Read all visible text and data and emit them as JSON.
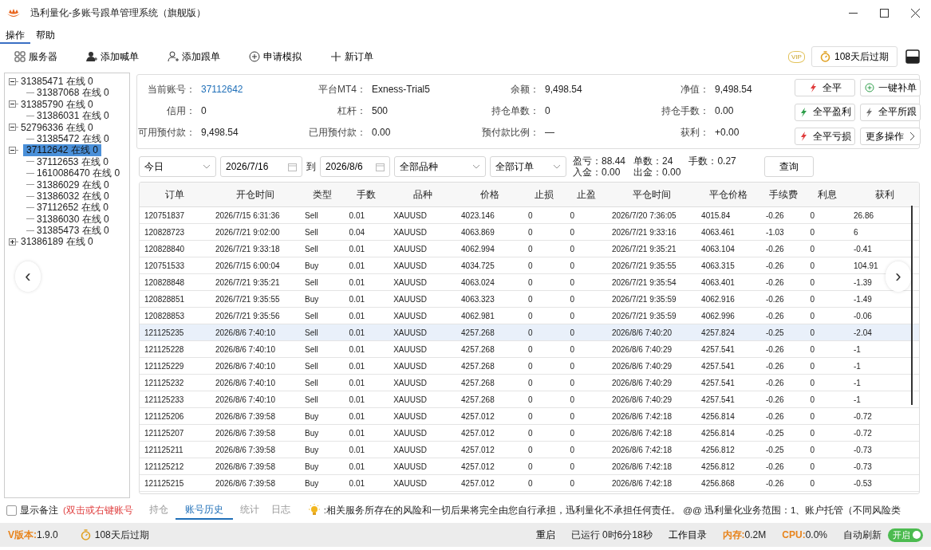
{
  "window": {
    "title": "迅利量化-多账号跟单管理系统（旗舰版）"
  },
  "menu": [
    {
      "label": "操作",
      "selected": true
    },
    {
      "label": "帮助",
      "selected": false
    }
  ],
  "toolbar": [
    "服务器",
    "添加喊单",
    "添加跟单",
    "申请模拟",
    "新订单"
  ],
  "vip": {
    "badge": "VIP",
    "expiry": "108天后过期"
  },
  "tree": [
    {
      "label": "31385471 在线 0",
      "selected": false,
      "expanded": true,
      "children": [
        {
          "label": "31387068 在线 0",
          "selected": false
        }
      ]
    },
    {
      "label": "31385790 在线 0",
      "selected": false,
      "expanded": true,
      "children": [
        {
          "label": "31386031 在线 0",
          "selected": false
        }
      ]
    },
    {
      "label": "52796336 在线 0",
      "selected": false,
      "expanded": true,
      "children": [
        {
          "label": "31385472 在线 0",
          "selected": false
        }
      ]
    },
    {
      "label": "37112642 在线 0",
      "selected": true,
      "expanded": true,
      "children": [
        {
          "label": "37112653 在线 0",
          "selected": false
        },
        {
          "label": "1610086470 在线 0",
          "selected": false
        },
        {
          "label": "31386029 在线 0",
          "selected": false
        },
        {
          "label": "31386032 在线 0",
          "selected": false
        },
        {
          "label": "37112652 在线 0",
          "selected": false
        },
        {
          "label": "31386030 在线 0",
          "selected": false
        },
        {
          "label": "31385473 在线 0",
          "selected": false
        }
      ]
    },
    {
      "label": "31386189 在线 0",
      "selected": false,
      "expanded": false
    }
  ],
  "account": {
    "fields": [
      {
        "label": "当前账号：",
        "value": "37112642",
        "kind": "link"
      },
      {
        "label": "平台MT4：",
        "value": "Exness-Trial5",
        "kind": "text"
      },
      {
        "label": "余额：",
        "value": "9,498.54",
        "kind": "text"
      },
      {
        "label": "净值：",
        "value": "9,498.54",
        "kind": "text"
      },
      {
        "label": "信用：",
        "value": "0",
        "kind": "text"
      },
      {
        "label": "杠杆：",
        "value": "500",
        "kind": "text"
      },
      {
        "label": "持仓单数：",
        "value": "0",
        "kind": "text"
      },
      {
        "label": "持仓手数：",
        "value": "0.00",
        "kind": "text"
      },
      {
        "label": "可用预付款：",
        "value": "9,498.54",
        "kind": "text"
      },
      {
        "label": "已用预付款：",
        "value": "0.00",
        "kind": "text"
      },
      {
        "label": "预付款比例：",
        "value": "—",
        "kind": "text"
      },
      {
        "label": "获利：",
        "value": "+0.00",
        "kind": "text"
      }
    ],
    "actions": [
      "全平",
      "一键补单",
      "全平盈利",
      "全平所跟",
      "全平亏损",
      "更多操作"
    ]
  },
  "filter": {
    "period": "今日",
    "date_from": "2026/7/16",
    "to": "到",
    "date_to": "2026/8/6",
    "symbol": "全部品种",
    "orders": "全部订单",
    "stats": [
      "盈亏：88.44",
      "单数：24",
      "手数：0.27",
      "入金：0.00",
      "出金：0.00"
    ],
    "query": "查询"
  },
  "table": {
    "columns": [
      "订单",
      "开仓时间",
      "类型",
      "手数",
      "品种",
      "价格",
      "止损",
      "止盈",
      "平仓时间",
      "平仓价格",
      "手续费",
      "利息",
      "获利"
    ],
    "rows": [
      {
        "selected": false,
        "cells": [
          "120751837",
          "2026/7/15 6:31:36",
          "Sell",
          "0.01",
          "XAUUSD",
          "4023.146",
          "0",
          "0",
          "2026/7/20 7:36:05",
          "4015.84",
          "-0.26",
          "0",
          "26.86"
        ]
      },
      {
        "selected": false,
        "cells": [
          "120828723",
          "2026/7/21 9:02:00",
          "Sell",
          "0.04",
          "XAUUSD",
          "4063.869",
          "0",
          "0",
          "2026/7/21 9:33:16",
          "4063.461",
          "-1.03",
          "0",
          "6"
        ]
      },
      {
        "selected": false,
        "cells": [
          "120828840",
          "2026/7/21 9:33:18",
          "Sell",
          "0.01",
          "XAUUSD",
          "4062.994",
          "0",
          "0",
          "2026/7/21 9:35:21",
          "4063.104",
          "-0.26",
          "0",
          "-0.41"
        ]
      },
      {
        "selected": false,
        "cells": [
          "120751533",
          "2026/7/15 6:00:04",
          "Buy",
          "0.01",
          "XAUUSD",
          "4034.725",
          "0",
          "0",
          "2026/7/21 9:35:55",
          "4063.315",
          "-0.26",
          "0",
          "104.91"
        ]
      },
      {
        "selected": false,
        "cells": [
          "120828848",
          "2026/7/21 9:35:21",
          "Sell",
          "0.01",
          "XAUUSD",
          "4063.024",
          "0",
          "0",
          "2026/7/21 9:35:54",
          "4063.401",
          "-0.26",
          "0",
          "-1.39"
        ]
      },
      {
        "selected": false,
        "cells": [
          "120828851",
          "2026/7/21 9:35:55",
          "Buy",
          "0.01",
          "XAUUSD",
          "4063.323",
          "0",
          "0",
          "2026/7/21 9:35:59",
          "4062.916",
          "-0.26",
          "0",
          "-1.49"
        ]
      },
      {
        "selected": false,
        "cells": [
          "120828853",
          "2026/7/21 9:35:56",
          "Sell",
          "0.01",
          "XAUUSD",
          "4062.981",
          "0",
          "0",
          "2026/7/21 9:35:59",
          "4062.996",
          "-0.26",
          "0",
          "-0.06"
        ]
      },
      {
        "selected": true,
        "cells": [
          "121125235",
          "2026/8/6 7:40:10",
          "Sell",
          "0.01",
          "XAUUSD",
          "4257.268",
          "0",
          "0",
          "2026/8/6 7:40:20",
          "4257.824",
          "-0.25",
          "0",
          "-2.04"
        ]
      },
      {
        "selected": false,
        "cells": [
          "121125228",
          "2026/8/6 7:40:10",
          "Sell",
          "0.01",
          "XAUUSD",
          "4257.268",
          "0",
          "0",
          "2026/8/6 7:40:29",
          "4257.541",
          "-0.26",
          "0",
          "-1"
        ]
      },
      {
        "selected": false,
        "cells": [
          "121125229",
          "2026/8/6 7:40:10",
          "Sell",
          "0.01",
          "XAUUSD",
          "4257.268",
          "0",
          "0",
          "2026/8/6 7:40:29",
          "4257.541",
          "-0.26",
          "0",
          "-1"
        ]
      },
      {
        "selected": false,
        "cells": [
          "121125232",
          "2026/8/6 7:40:10",
          "Sell",
          "0.01",
          "XAUUSD",
          "4257.268",
          "0",
          "0",
          "2026/8/6 7:40:29",
          "4257.541",
          "-0.26",
          "0",
          "-1"
        ]
      },
      {
        "selected": false,
        "cells": [
          "121125233",
          "2026/8/6 7:40:10",
          "Sell",
          "0.01",
          "XAUUSD",
          "4257.268",
          "0",
          "0",
          "2026/8/6 7:40:29",
          "4257.541",
          "-0.26",
          "0",
          "-1"
        ]
      },
      {
        "selected": false,
        "cells": [
          "121125206",
          "2026/8/6 7:39:58",
          "Buy",
          "0.01",
          "XAUUSD",
          "4257.012",
          "0",
          "0",
          "2026/8/6 7:42:18",
          "4256.814",
          "-0.26",
          "0",
          "-0.72"
        ]
      },
      {
        "selected": false,
        "cells": [
          "121125207",
          "2026/8/6 7:39:58",
          "Buy",
          "0.01",
          "XAUUSD",
          "4257.012",
          "0",
          "0",
          "2026/8/6 7:42:18",
          "4256.814",
          "-0.25",
          "0",
          "-0.72"
        ]
      },
      {
        "selected": false,
        "cells": [
          "121125211",
          "2026/8/6 7:39:58",
          "Buy",
          "0.01",
          "XAUUSD",
          "4257.012",
          "0",
          "0",
          "2026/8/6 7:42:18",
          "4256.812",
          "-0.25",
          "0",
          "-0.73"
        ]
      },
      {
        "selected": false,
        "cells": [
          "121125212",
          "2026/8/6 7:39:58",
          "Buy",
          "0.01",
          "XAUUSD",
          "4257.012",
          "0",
          "0",
          "2026/8/6 7:42:18",
          "4256.812",
          "-0.26",
          "0",
          "-0.73"
        ]
      },
      {
        "selected": false,
        "cells": [
          "121125215",
          "2026/8/6 7:39:58",
          "Buy",
          "0.01",
          "XAUUSD",
          "4257.012",
          "0",
          "0",
          "2026/8/6 7:42:18",
          "4256.868",
          "-0.26",
          "0",
          "-0.53"
        ]
      }
    ]
  },
  "nav_arrows": [
    "‹",
    "›"
  ],
  "bottom": {
    "show_notes": {
      "label": "显示备注",
      "checked": false
    },
    "hint": "(双击或右键账号",
    "tabs": [
      {
        "label": "持仓",
        "selected": false
      },
      {
        "label": "账号历史",
        "selected": true
      },
      {
        "label": "统计",
        "selected": false
      },
      {
        "label": "日志",
        "selected": false
      }
    ],
    "notice": ":相关服务所存在的风险和一切后果将完全由您自行承担，迅利量化不承担任何责任。   @@ 迅利量化业务范围：1、账户托管（不同风险类"
  },
  "status": {
    "version": {
      "label": "V版本:",
      "value": "1.9.0"
    },
    "expiry": "108天后过期",
    "restart": "重启",
    "uptime": "已运行 0时6分18秒",
    "workdir": "工作目录",
    "memory": {
      "label": "内存:",
      "value": "0.2M"
    },
    "cpu": {
      "label": "CPU:",
      "value": "0.0%"
    },
    "auto_refresh": {
      "label": "自动刷新",
      "toggle": "开启",
      "on": true
    }
  }
}
